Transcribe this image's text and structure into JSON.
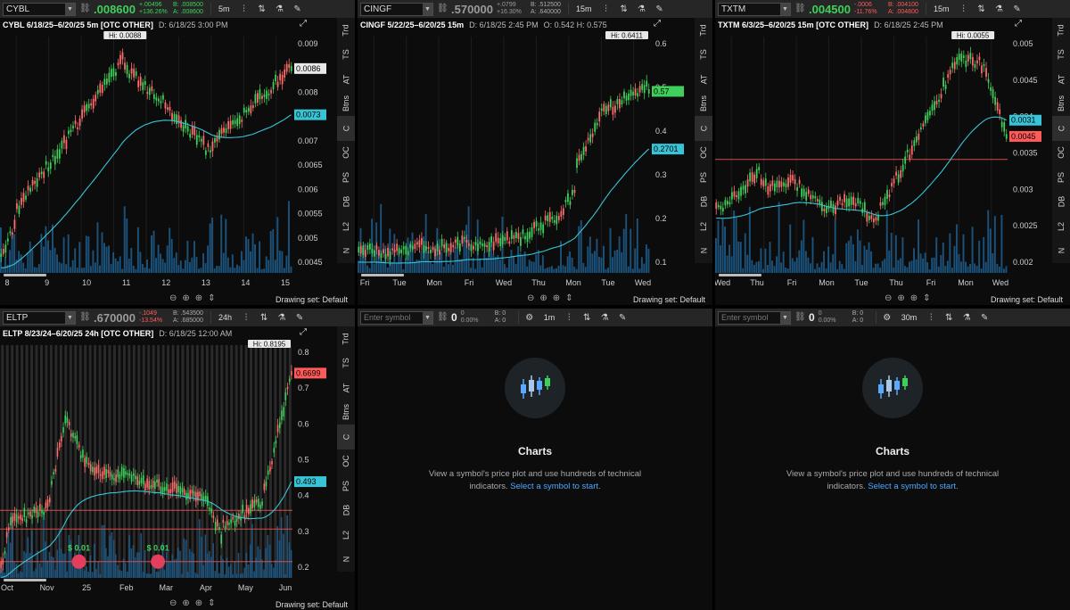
{
  "colors": {
    "up": "#3ed05a",
    "down": "#ff6b6b",
    "ma": "#37c4d6",
    "volume": "#1f5f8f",
    "resistance": "#d44d4d",
    "accent_link": "#4ea8ff"
  },
  "common": {
    "drawing_set": "Drawing set: Default",
    "icons": [
      "zoom-out-icon",
      "zoom-in-icon",
      "crosshair-icon",
      "pan-icon"
    ]
  },
  "side_tabs": [
    "Trd",
    "TS",
    "AT",
    "Btns",
    "C",
    "OC",
    "PS",
    "DB",
    "L2",
    "N"
  ],
  "panels": [
    {
      "id": "cybl",
      "symbol": "CYBL",
      "price": ".008600",
      "price_color": "green",
      "change": "+.00496",
      "change_pct": "+136.26%",
      "bid": "B: .008500",
      "ask": "A: .008600",
      "timeframe": "5m",
      "chart_title": "CYBL 6/18/25–6/20/25 5m [OTC OTHER]",
      "date_stamp": "D: 6/18/25 3:00 PM",
      "hi_label": "Hi: 0.0088",
      "last_tag": "0.0086",
      "ma_tag": "0.0073",
      "y_ticks": [
        "0.009",
        "0.0085",
        "0.008",
        "0.0075",
        "0.007",
        "0.0065",
        "0.006",
        "0.0055",
        "0.005",
        "0.0045"
      ],
      "x_ticks": [
        "8",
        "9",
        "10",
        "11",
        "12",
        "13",
        "14",
        "15"
      ]
    },
    {
      "id": "cingf",
      "symbol": "CINGF",
      "price": ".570000",
      "price_color": "gray",
      "change": "+.0799",
      "change_pct": "+16.30%",
      "bid": "B: .512500",
      "ask": "A: .640000",
      "timeframe": "15m",
      "chart_title": "CINGF 5/22/25–6/20/25 15m",
      "date_stamp": "D: 6/18/25 2:45 PM",
      "ohlc": "O: 0.542   H: 0.575",
      "hi_label": "Hi: 0.6411",
      "last_tag": "0.57",
      "ma_tag": "0.2701",
      "y_ticks": [
        "0.6",
        "0.5",
        "0.4",
        "0.3",
        "0.2",
        "0.1"
      ],
      "x_ticks": [
        "Fri",
        "Tue",
        "Mon",
        "Fri",
        "Wed",
        "Thu",
        "Mon",
        "Tue",
        "Wed"
      ]
    },
    {
      "id": "txtm",
      "symbol": "TXTM",
      "price": ".004500",
      "price_color": "green",
      "change": "-.0006",
      "change_pct": "-11.76%",
      "bid": "B: .004100",
      "ask": "A: .004800",
      "timeframe": "15m",
      "chart_title": "TXTM 6/3/25–6/20/25 15m [OTC OTHER]",
      "date_stamp": "D: 6/18/25 2:45 PM",
      "hi_label": "Hi: 0.0055",
      "last_tag": "0.0045",
      "ma_tag": "0.0031",
      "y_ticks": [
        "0.005",
        "0.0045",
        "0.004",
        "0.0035",
        "0.003",
        "0.0025",
        "0.002"
      ],
      "x_ticks": [
        "Wed",
        "Thu",
        "Fri",
        "Mon",
        "Tue",
        "Thu",
        "Fri",
        "Mon",
        "Wed"
      ]
    },
    {
      "id": "eltp",
      "symbol": "ELTP",
      "price": ".670000",
      "price_color": "gray",
      "change": "-.1049",
      "change_pct": "-13.54%",
      "bid": "B: .543500",
      "ask": "A: .685000",
      "timeframe": "24h",
      "chart_title": "ELTP 8/23/24–6/20/25 24h [OTC OTHER]",
      "date_stamp": "D: 6/18/25 12:00 AM",
      "hi_label": "Hi: 0.8195",
      "last_tag": "0.6699",
      "ma_tag": "0.493",
      "dividend_labels": [
        "$ 0.01",
        "$ 0.01"
      ],
      "y_ticks": [
        "0.8",
        "0.7",
        "0.6",
        "0.5",
        "0.4",
        "0.3",
        "0.2"
      ],
      "x_ticks": [
        "Oct",
        "Nov",
        "25",
        "Feb",
        "Mar",
        "Apr",
        "May",
        "Jun"
      ]
    }
  ],
  "empty_panels": [
    {
      "id": "empty1",
      "placeholder": "Enter symbol",
      "zero": "0",
      "pct": "0.00%",
      "bid": "B: 0",
      "ask": "A: 0",
      "timeframe": "1m",
      "title": "Charts",
      "desc": "View a symbol's price plot and use hundreds of technical indicators.",
      "link": "Select a symbol to start."
    },
    {
      "id": "empty2",
      "placeholder": "Enter symbol",
      "zero": "0",
      "pct": "0.00%",
      "bid": "B: 0",
      "ask": "A: 0",
      "timeframe": "30m",
      "title": "Charts",
      "desc": "View a symbol's price plot and use hundreds of technical indicators.",
      "link": "Select a symbol to start."
    }
  ]
}
